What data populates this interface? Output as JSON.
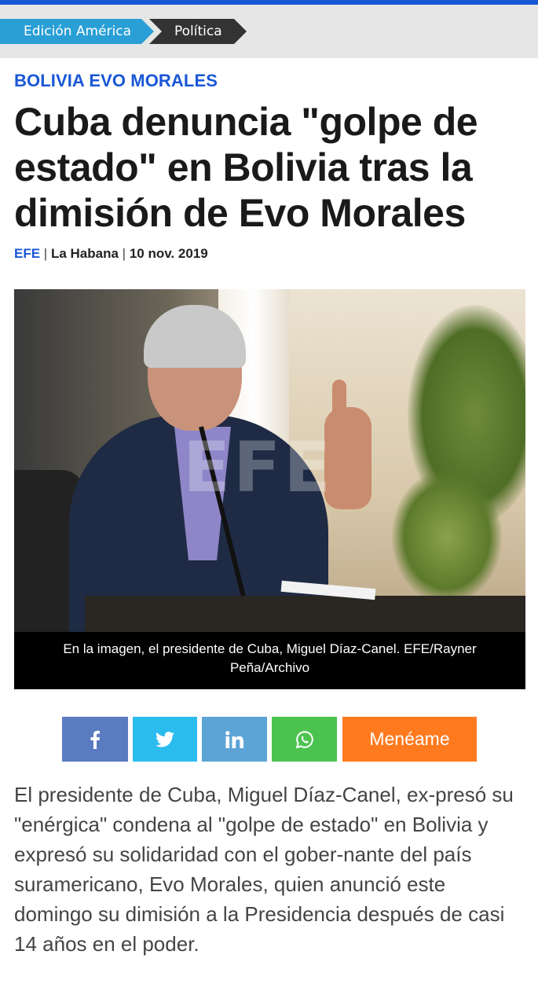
{
  "breadcrumb": {
    "edition": "Edición América",
    "section": "Política"
  },
  "article": {
    "kicker": "BOLIVIA EVO MORALES",
    "headline": "Cuba denuncia \"golpe de estado\" en Bolivia tras la dimisión de Evo Morales",
    "byline": {
      "agency": "EFE",
      "separator": "|",
      "location": "La Habana",
      "date": "10 nov. 2019"
    },
    "photo": {
      "watermark": "EFE",
      "caption": "En la imagen, el presidente de Cuba, Miguel Díaz-Canel. EFE/Rayner Peña/Archivo"
    },
    "share": {
      "facebook_icon": "facebook-icon",
      "twitter_icon": "twitter-icon",
      "linkedin_icon": "linkedin-icon",
      "whatsapp_icon": "whatsapp-icon",
      "meneame_label": "Menéame"
    },
    "body": "El presidente de Cuba, Miguel Díaz-Canel, ex-presó su \"enérgica\" condena al \"golpe de estado\" en Bolivia y expresó su solidaridad con el gober-nante del país suramericano, Evo Morales, quien anunció este domingo su dimisión a la Presidencia después de casi 14 años en el poder."
  },
  "colors": {
    "accent": "#1a57d6",
    "breadcrumb_blue": "#2a9fd6",
    "breadcrumb_dark": "#333333",
    "facebook": "#5b7bc1",
    "twitter": "#2bbcee",
    "linkedin": "#5da4d6",
    "whatsapp": "#4cc34f",
    "meneame": "#ff7a1f"
  }
}
